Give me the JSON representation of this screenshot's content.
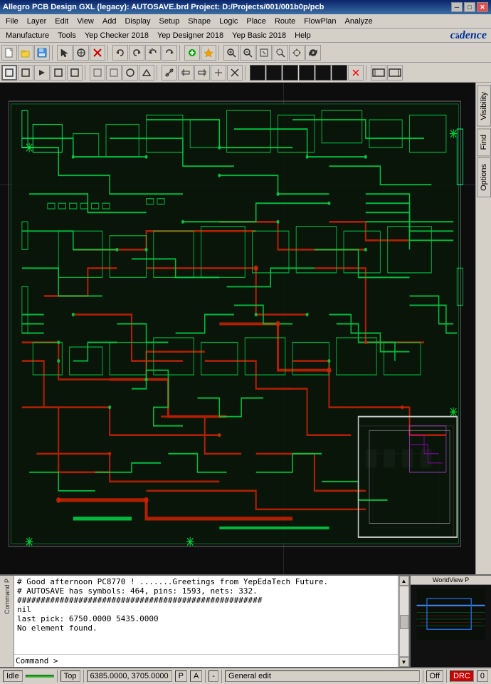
{
  "titleBar": {
    "title": "Allegro PCB Design GXL (legacy): AUTOSAVE.brd  Project: D:/Projects/001/001b0p/pcb",
    "minBtn": "─",
    "maxBtn": "□",
    "closeBtn": "✕"
  },
  "menuBar1": {
    "items": [
      "File",
      "Layer",
      "Edit",
      "View",
      "Add",
      "Display",
      "Setup",
      "Shape",
      "Logic",
      "Place",
      "Route",
      "FlowPlan",
      "Analyze"
    ]
  },
  "menuBar2": {
    "items": [
      "Manufacture",
      "Tools",
      "Yep Checker 2018",
      "Yep Designer 2018",
      "Yep Basic 2018",
      "Help"
    ],
    "logo": "cādence"
  },
  "rightPanel": {
    "tabs": [
      "Visibility",
      "Find",
      "Options"
    ]
  },
  "console": {
    "lines": [
      "# Good afternoon PC8770 !       .......Greetings from YepEdaTech Future.",
      "# AUTOSAVE has symbols: 464, pins: 1593, nets: 332.",
      "####################################################",
      "nil",
      "last pick:  6750.0000 5435.0000",
      "No element found."
    ],
    "prompt": "Command >"
  },
  "statusBar": {
    "idle": "Idle",
    "greenIndicator": "",
    "layer": "Top",
    "coords": "6385.0000, 3705.0000",
    "coordUnit": "P",
    "coordA": "A",
    "separator": "-",
    "mode": "General edit",
    "off": "Off",
    "drc": "DRC",
    "counter": "0"
  },
  "toolbar1": {
    "buttons": [
      "📄",
      "📂",
      "💾",
      "✂",
      "📋",
      "✖",
      "↩",
      "↪",
      "↩↩",
      "↪↪",
      "⊕",
      "📌",
      "🖼",
      "🔍",
      "🔍",
      "🔍",
      "🔍",
      "🔭",
      "🔄",
      "🔄",
      "⋮"
    ]
  },
  "toolbar2": {
    "buttons": [
      "⬜",
      "⬜",
      "▷",
      "⬜",
      "⬜",
      "⬜",
      "⬜",
      "⬜",
      "⬜",
      "⬜",
      "⬜",
      "⬜",
      "⬜",
      "⬜",
      "⬜",
      "⬜",
      "⬜",
      "✖",
      "⬛",
      "⬛",
      "⬛",
      "⬛",
      "⬛",
      "⬛",
      "⬛"
    ]
  },
  "worldview": {
    "label": "WorldView"
  }
}
